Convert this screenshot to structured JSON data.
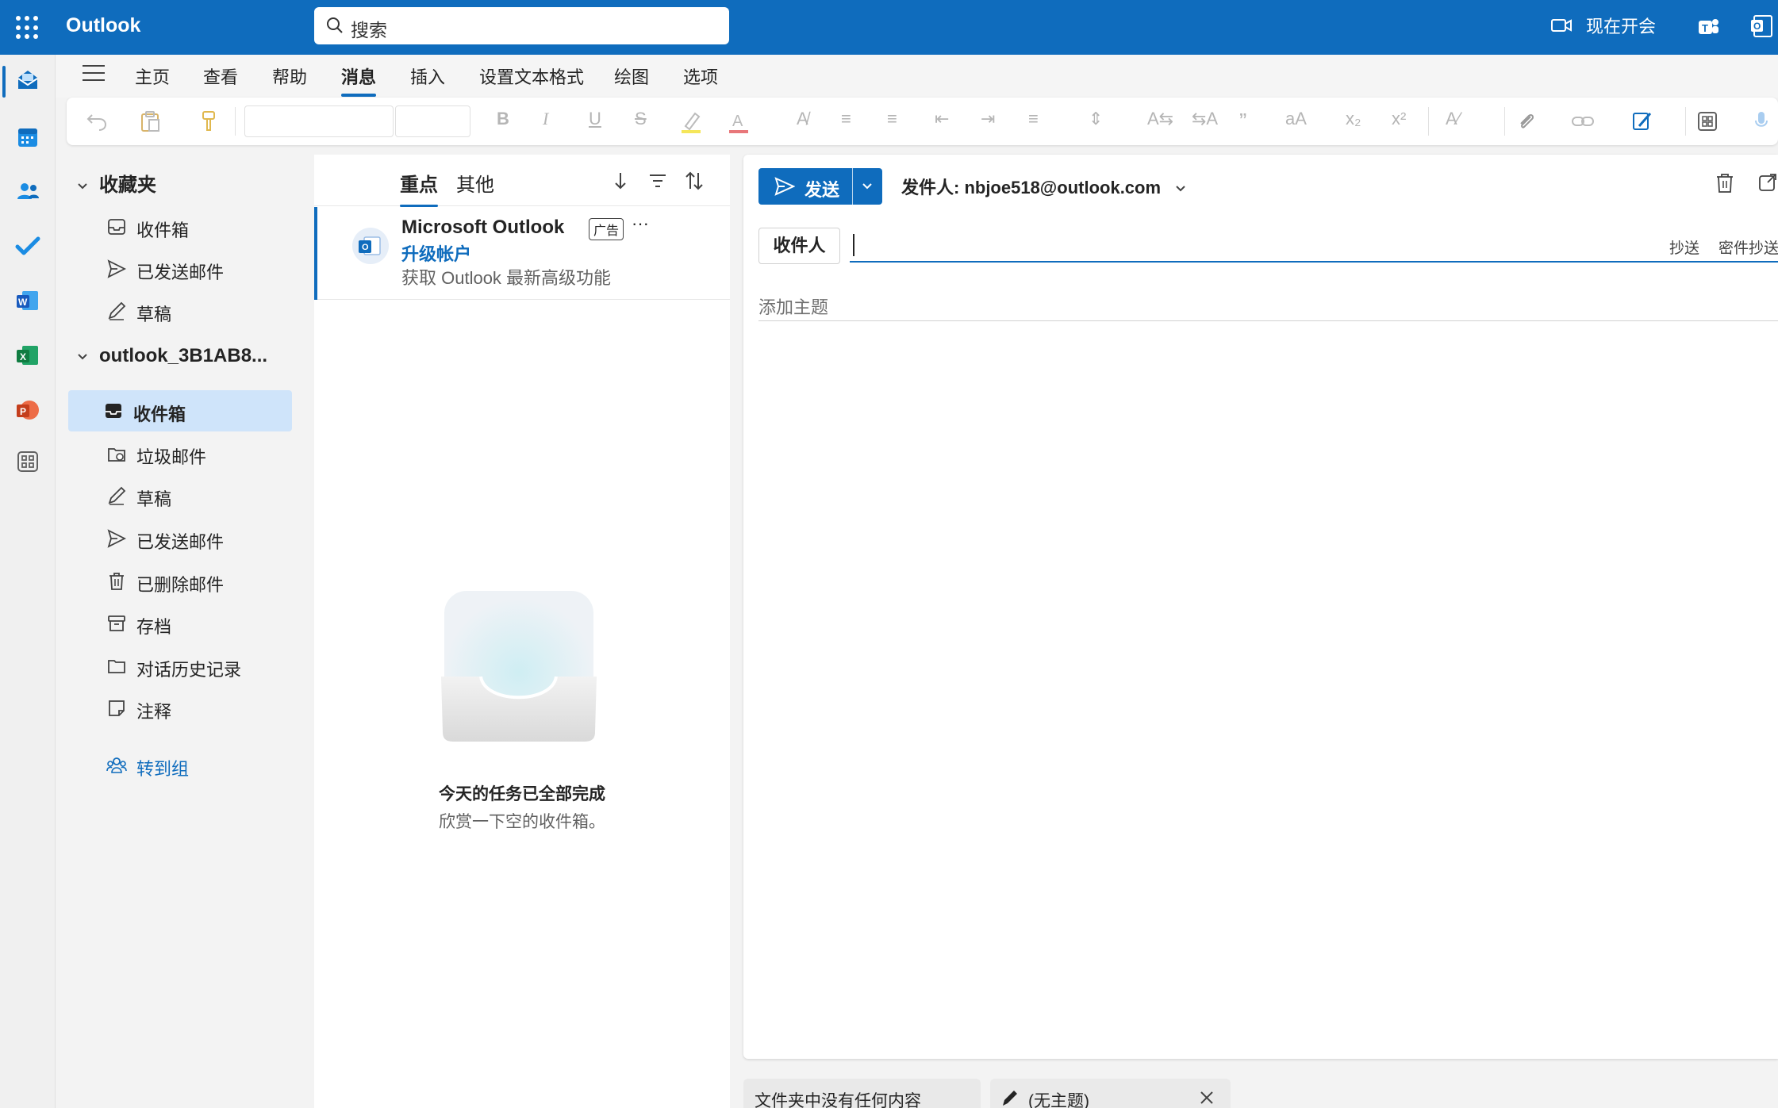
{
  "app": {
    "title": "Outlook",
    "accent": "#0f6cbd"
  },
  "search": {
    "placeholder": "搜索"
  },
  "topbar": {
    "meet_now": "现在开会"
  },
  "ribbon": {
    "tabs": [
      "主页",
      "查看",
      "帮助",
      "消息",
      "插入",
      "设置文本格式",
      "绘图",
      "选项"
    ],
    "active_tab": "消息"
  },
  "folders": {
    "favorites_header": "收藏夹",
    "favorites": [
      "收件箱",
      "已发送邮件",
      "草稿"
    ],
    "account_header": "outlook_3B1AB8...",
    "account_folders": [
      "收件箱",
      "垃圾邮件",
      "草稿",
      "已发送邮件",
      "已删除邮件",
      "存档",
      "对话历史记录",
      "注释"
    ],
    "selected": "收件箱",
    "go_to_groups": "转到组"
  },
  "message_list": {
    "tabs": [
      "重点",
      "其他"
    ],
    "active_tab": "重点",
    "ad": {
      "sender": "Microsoft Outlook",
      "badge": "广告",
      "more": "···",
      "subject": "升级帐户",
      "preview": "获取 Outlook 最新高级功能"
    },
    "empty_title": "今天的任务已全部完成",
    "empty_subtitle": "欣赏一下空的收件箱。"
  },
  "compose": {
    "send_label": "发送",
    "from_label": "发件人: nbjoe518@outlook.com",
    "to_label": "收件人",
    "cc_label": "抄送",
    "bcc_label": "密件抄送",
    "subject_placeholder": "添加主题"
  },
  "bottom_tabs": {
    "folder_empty": "文件夹中没有任何内容",
    "draft": "(无主题)"
  }
}
